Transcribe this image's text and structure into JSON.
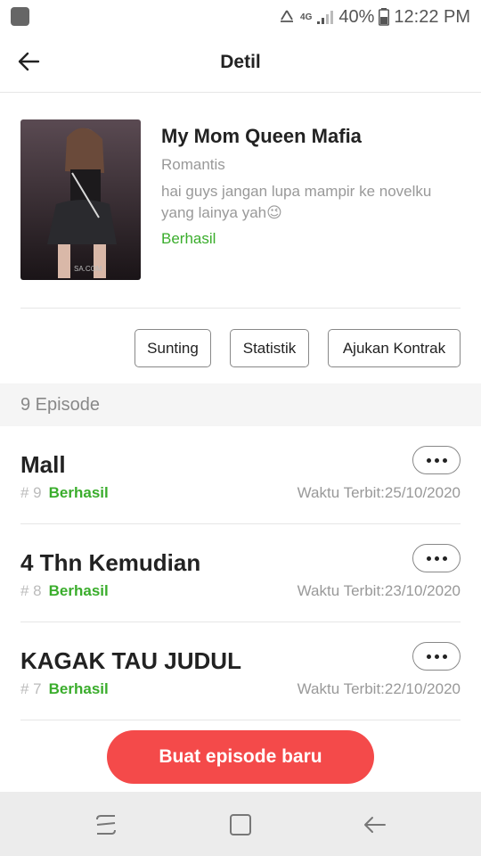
{
  "status_bar": {
    "network": "4G",
    "battery": "40%",
    "time": "12:22 PM"
  },
  "header": {
    "title": "Detil"
  },
  "book": {
    "title": "My Mom Queen Mafia",
    "genre": "Romantis",
    "description": "hai guys jangan lupa mampir ke novelku yang lainya yah😉",
    "status": "Berhasil",
    "cover_watermark": "SA.COM"
  },
  "actions": {
    "edit_label": "Sunting",
    "stats_label": "Statistik",
    "contract_label": "Ajukan Kontrak"
  },
  "episodes_header": {
    "count_label": "9 Episode"
  },
  "episodes": [
    {
      "title": "Mall",
      "number": "# 9",
      "status": "Berhasil",
      "published_label": "Waktu Terbit:",
      "published_date": "25/10/2020"
    },
    {
      "title": "4 Thn Kemudian",
      "number": "# 8",
      "status": "Berhasil",
      "published_label": "Waktu Terbit:",
      "published_date": "23/10/2020"
    },
    {
      "title": "KAGAK TAU JUDUL",
      "number": "# 7",
      "status": "Berhasil",
      "published_label": "Waktu Terbit:",
      "published_date": "22/10/2020"
    }
  ],
  "bottom": {
    "create_label": "Buat episode baru"
  },
  "nav_bar": {
    "icons": [
      "recent-apps-icon",
      "home-icon",
      "back-icon"
    ]
  },
  "colors": {
    "accent": "#f44a4a",
    "success": "#3aad2c",
    "muted": "#999999"
  }
}
